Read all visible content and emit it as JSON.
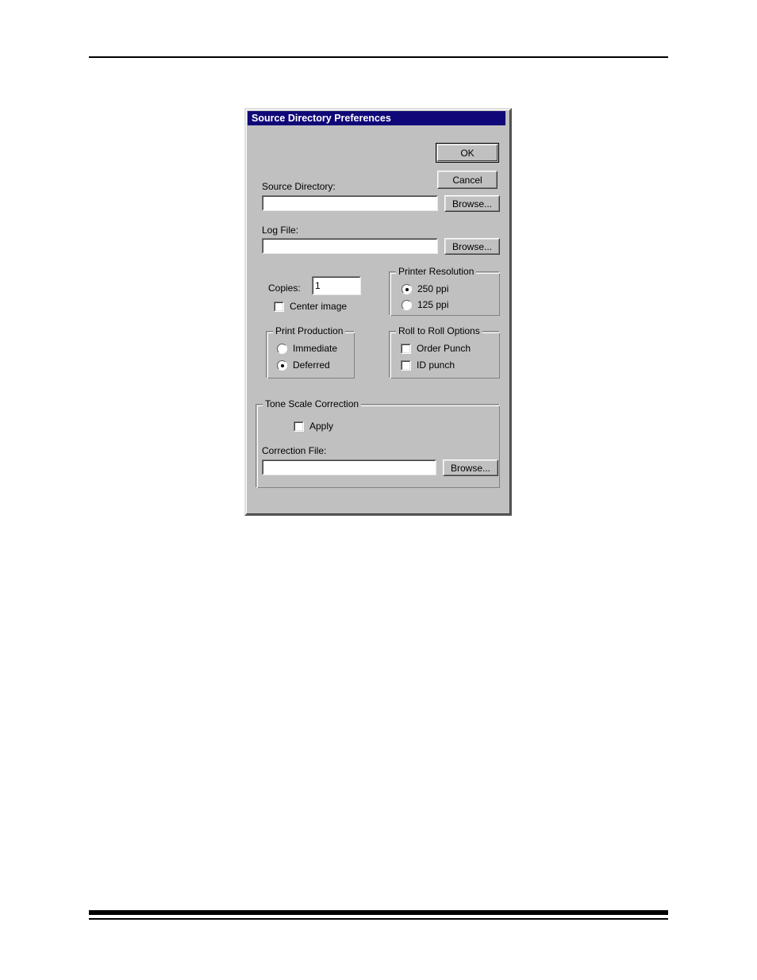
{
  "page": {
    "background": "#ffffff",
    "rules": [
      "header-rule",
      "footer-rule-thick",
      "footer-rule-thin"
    ]
  },
  "dialog": {
    "title": "Source Directory Preferences",
    "titlebar_color": "#100878",
    "face_color": "#c0c0c0",
    "buttons": {
      "ok": "OK",
      "cancel": "Cancel",
      "browse_source": "Browse...",
      "browse_log": "Browse...",
      "browse_correction": "Browse..."
    },
    "fields": {
      "source_directory": {
        "label": "Source Directory:",
        "value": "",
        "placeholder": ""
      },
      "log_file": {
        "label": "Log File:",
        "value": "",
        "placeholder": ""
      },
      "copies": {
        "label": "Copies:",
        "value": "1"
      },
      "correction_file": {
        "label": "Correction File:",
        "value": "",
        "placeholder": ""
      }
    },
    "checkboxes": {
      "center_image": {
        "label": "Center image",
        "checked": false
      },
      "order_punch": {
        "label": "Order Punch",
        "checked": false
      },
      "id_punch": {
        "label": "ID punch",
        "checked": false
      },
      "apply": {
        "label": "Apply",
        "checked": false
      }
    },
    "groups": {
      "printer_resolution": {
        "title": "Printer Resolution",
        "options": [
          {
            "label": "250 ppi",
            "selected": true
          },
          {
            "label": "125 ppi",
            "selected": false
          }
        ]
      },
      "print_production": {
        "title": "Print Production",
        "options": [
          {
            "label": "Immediate",
            "selected": false
          },
          {
            "label": "Deferred",
            "selected": true
          }
        ]
      },
      "roll_to_roll": {
        "title": "Roll to Roll Options"
      },
      "tone_scale_correction": {
        "title": "Tone Scale Correction"
      }
    }
  }
}
